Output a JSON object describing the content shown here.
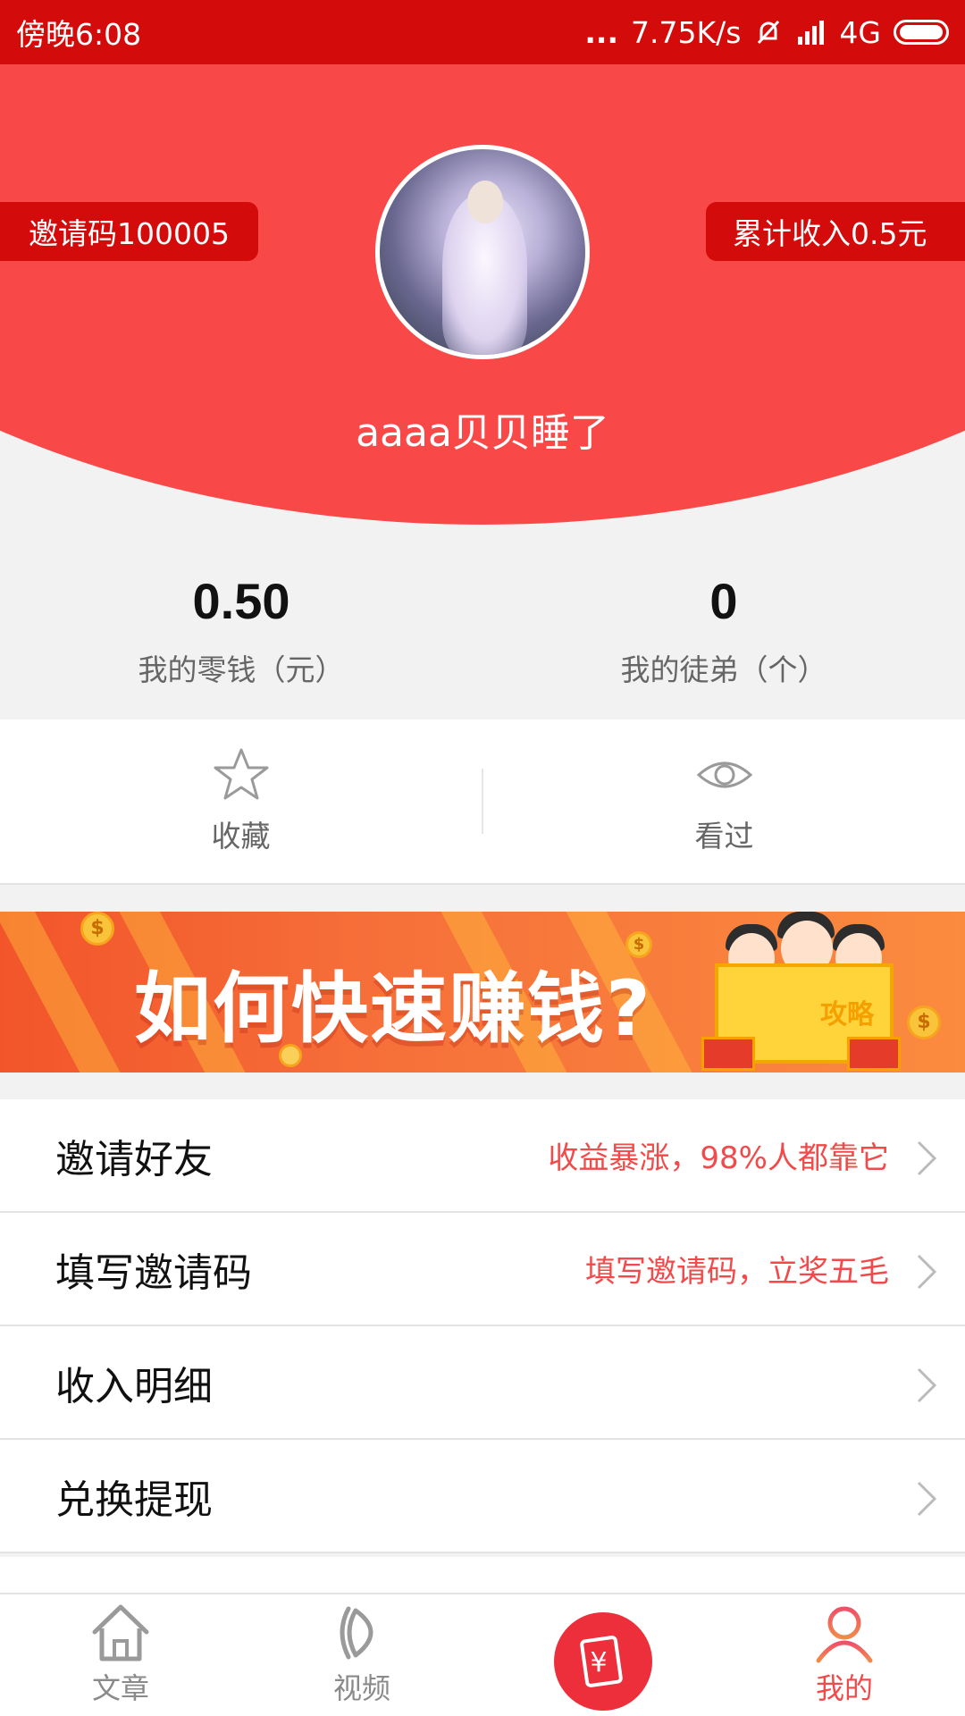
{
  "status_bar": {
    "time": "傍晚6:08",
    "net_speed": "7.75K/s",
    "network": "4G",
    "dots": "..."
  },
  "profile": {
    "invite_code_label": "邀请码100005",
    "total_income_label": "累计收入0.5元",
    "username": "aaaa贝贝睡了"
  },
  "stats": [
    {
      "value": "0.50",
      "label": "我的零钱（元）"
    },
    {
      "value": "0",
      "label": "我的徒弟（个）"
    }
  ],
  "quick_actions": [
    {
      "label": "收藏",
      "icon": "star-icon"
    },
    {
      "label": "看过",
      "icon": "eye-icon"
    }
  ],
  "banner": {
    "text": "如何快速赚钱?",
    "book_label": "攻略",
    "coin_symbol": "$"
  },
  "menu": [
    {
      "title": "邀请好友",
      "hint": "收益暴涨，98%人都靠它"
    },
    {
      "title": "填写邀请码",
      "hint": "填写邀请码，立奖五毛"
    },
    {
      "title": "收入明细",
      "hint": ""
    },
    {
      "title": "兑换提现",
      "hint": ""
    }
  ],
  "tabs": [
    {
      "label": "文章",
      "icon": "home-icon"
    },
    {
      "label": "视频",
      "icon": "video-icon"
    },
    {
      "label": "",
      "icon": "red-envelope-icon",
      "symbol": "¥"
    },
    {
      "label": "我的",
      "icon": "person-icon"
    }
  ],
  "colors": {
    "header_red": "#f94848",
    "dark_red": "#d40b0b",
    "accent": "#f24a4a",
    "center_button": "#ec2f3a"
  }
}
